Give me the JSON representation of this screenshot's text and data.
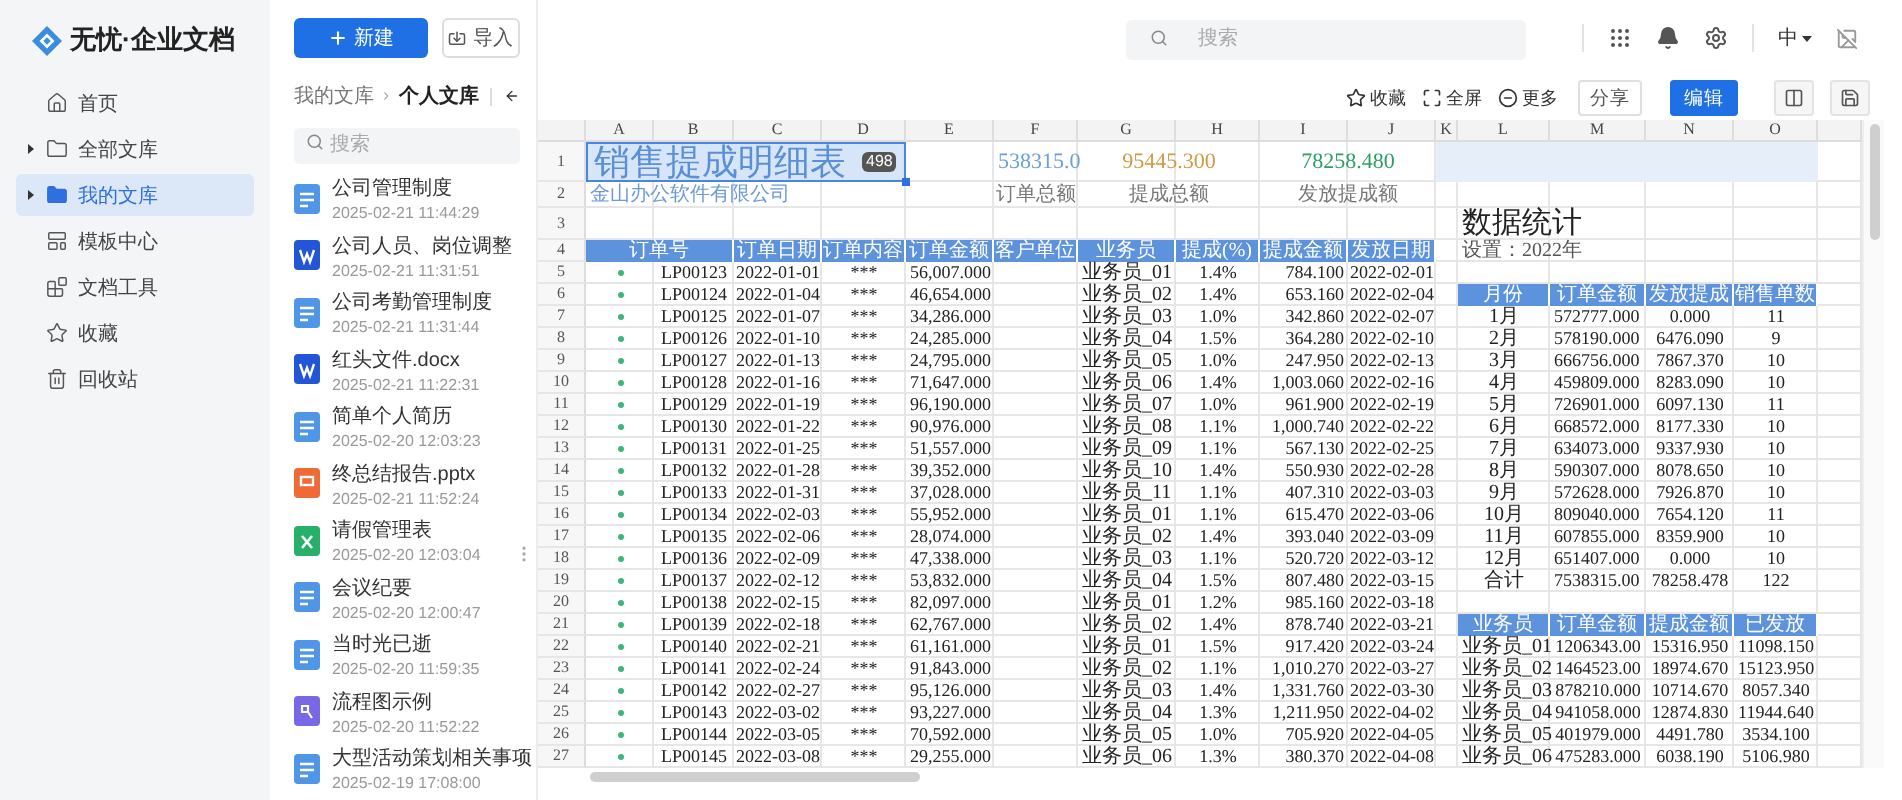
{
  "brand": {
    "name": "无忧·企业文档"
  },
  "sidebar": {
    "items": [
      {
        "label": "首页",
        "kind": "home",
        "expandable": false,
        "selected": false
      },
      {
        "label": "全部文库",
        "kind": "folder",
        "expandable": true,
        "selected": false
      },
      {
        "label": "我的文库",
        "kind": "folder",
        "expandable": true,
        "selected": true
      },
      {
        "label": "模板中心",
        "kind": "template",
        "expandable": false,
        "selected": false
      },
      {
        "label": "文档工具",
        "kind": "tools",
        "expandable": false,
        "selected": false
      },
      {
        "label": "收藏",
        "kind": "star",
        "expandable": false,
        "selected": false
      },
      {
        "label": "回收站",
        "kind": "trash",
        "expandable": false,
        "selected": false
      }
    ]
  },
  "doc_panel": {
    "new_button": "新建",
    "import_button": "导入",
    "breadcrumb": {
      "parent": "我的文库",
      "current": "个人文库"
    },
    "search": {
      "placeholder": "搜索"
    },
    "documents": [
      {
        "title": "公司管理制度",
        "time": "2025-02-21 11:44:29",
        "kind": "text"
      },
      {
        "title": "公司人员、岗位调整",
        "time": "2025-02-21 11:31:51",
        "kind": "word"
      },
      {
        "title": "公司考勤管理制度",
        "time": "2025-02-21 11:31:44",
        "kind": "text"
      },
      {
        "title": "红头文件.docx",
        "time": "2025-02-21 11:22:31",
        "kind": "word"
      },
      {
        "title": "简单个人简历",
        "time": "2025-02-20 12:03:23",
        "kind": "text"
      },
      {
        "title": "终总结报告.pptx",
        "time": "2025-02-21 11:52:24",
        "kind": "slides"
      },
      {
        "title": "请假管理表",
        "time": "2025-02-20 12:03:04",
        "kind": "sheet"
      },
      {
        "title": "会议纪要",
        "time": "2025-02-20 12:00:47",
        "kind": "text"
      },
      {
        "title": "当时光已逝",
        "time": "2025-02-20 11:59:35",
        "kind": "text"
      },
      {
        "title": "流程图示例",
        "time": "2025-02-20 11:52:22",
        "kind": "flow"
      },
      {
        "title": "大型活动策划相关事项",
        "time": "2025-02-19 17:08:00",
        "kind": "text"
      }
    ]
  },
  "header": {
    "search": {
      "placeholder": "搜索"
    },
    "language": "中"
  },
  "toolbar": {
    "favorite": "收藏",
    "fullscreen": "全屏",
    "more": "更多",
    "share": "分享",
    "edit": "编辑"
  },
  "sheet": {
    "columns": [
      "A",
      "B",
      "C",
      "D",
      "E",
      "F",
      "G",
      "H",
      "I",
      "J",
      "K",
      "L",
      "M",
      "N",
      "O"
    ],
    "row_numbers": [
      "1",
      "2",
      "3",
      "4",
      "5",
      "6",
      "7",
      "8",
      "9",
      "10",
      "11",
      "12",
      "13",
      "14",
      "15",
      "16",
      "17",
      "18",
      "19",
      "20",
      "21",
      "22",
      "23",
      "24",
      "25",
      "26",
      "27"
    ],
    "title": "销售提成明细表",
    "selection_badge": "498",
    "company": "金山办公软件有限公司",
    "summary": [
      {
        "value": "538315.0",
        "label": "订单总额",
        "color": "#6a9fd8"
      },
      {
        "value": "95445.300",
        "label": "提成总额",
        "color": "#d19a45"
      },
      {
        "value": "78258.480",
        "label": "发放提成额",
        "color": "#2f9e63"
      }
    ],
    "table": {
      "columns": [
        "订单号",
        "订单日期",
        "订单内容",
        "订单金额",
        "客户单位",
        "业务员",
        "提成(%)",
        "提成金额",
        "发放日期"
      ],
      "rows": [
        [
          "LP00123",
          "2022-01-01",
          "***",
          "56,007.000",
          "",
          "业务员_01",
          "1.4%",
          "784.100",
          "2022-02-01"
        ],
        [
          "LP00124",
          "2022-01-04",
          "***",
          "46,654.000",
          "",
          "业务员_02",
          "1.4%",
          "653.160",
          "2022-02-04"
        ],
        [
          "LP00125",
          "2022-01-07",
          "***",
          "34,286.000",
          "",
          "业务员_03",
          "1.0%",
          "342.860",
          "2022-02-07"
        ],
        [
          "LP00126",
          "2022-01-10",
          "***",
          "24,285.000",
          "",
          "业务员_04",
          "1.5%",
          "364.280",
          "2022-02-10"
        ],
        [
          "LP00127",
          "2022-01-13",
          "***",
          "24,795.000",
          "",
          "业务员_05",
          "1.0%",
          "247.950",
          "2022-02-13"
        ],
        [
          "LP00128",
          "2022-01-16",
          "***",
          "71,647.000",
          "",
          "业务员_06",
          "1.4%",
          "1,003.060",
          "2022-02-16"
        ],
        [
          "LP00129",
          "2022-01-19",
          "***",
          "96,190.000",
          "",
          "业务员_07",
          "1.0%",
          "961.900",
          "2022-02-19"
        ],
        [
          "LP00130",
          "2022-01-22",
          "***",
          "90,976.000",
          "",
          "业务员_08",
          "1.1%",
          "1,000.740",
          "2022-02-22"
        ],
        [
          "LP00131",
          "2022-01-25",
          "***",
          "51,557.000",
          "",
          "业务员_09",
          "1.1%",
          "567.130",
          "2022-02-25"
        ],
        [
          "LP00132",
          "2022-01-28",
          "***",
          "39,352.000",
          "",
          "业务员_10",
          "1.4%",
          "550.930",
          "2022-02-28"
        ],
        [
          "LP00133",
          "2022-01-31",
          "***",
          "37,028.000",
          "",
          "业务员_11",
          "1.1%",
          "407.310",
          "2022-03-03"
        ],
        [
          "LP00134",
          "2022-02-03",
          "***",
          "55,952.000",
          "",
          "业务员_01",
          "1.1%",
          "615.470",
          "2022-03-06"
        ],
        [
          "LP00135",
          "2022-02-06",
          "***",
          "28,074.000",
          "",
          "业务员_02",
          "1.4%",
          "393.040",
          "2022-03-09"
        ],
        [
          "LP00136",
          "2022-02-09",
          "***",
          "47,338.000",
          "",
          "业务员_03",
          "1.1%",
          "520.720",
          "2022-03-12"
        ],
        [
          "LP00137",
          "2022-02-12",
          "***",
          "53,832.000",
          "",
          "业务员_04",
          "1.5%",
          "807.480",
          "2022-03-15"
        ],
        [
          "LP00138",
          "2022-02-15",
          "***",
          "82,097.000",
          "",
          "业务员_01",
          "1.2%",
          "985.160",
          "2022-03-18"
        ],
        [
          "LP00139",
          "2022-02-18",
          "***",
          "62,767.000",
          "",
          "业务员_02",
          "1.4%",
          "878.740",
          "2022-03-21"
        ],
        [
          "LP00140",
          "2022-02-21",
          "***",
          "61,161.000",
          "",
          "业务员_01",
          "1.5%",
          "917.420",
          "2022-03-24"
        ],
        [
          "LP00141",
          "2022-02-24",
          "***",
          "91,843.000",
          "",
          "业务员_02",
          "1.1%",
          "1,010.270",
          "2022-03-27"
        ],
        [
          "LP00142",
          "2022-02-27",
          "***",
          "95,126.000",
          "",
          "业务员_03",
          "1.4%",
          "1,331.760",
          "2022-03-30"
        ],
        [
          "LP00143",
          "2022-03-02",
          "***",
          "93,227.000",
          "",
          "业务员_04",
          "1.3%",
          "1,211.950",
          "2022-04-02"
        ],
        [
          "LP00144",
          "2022-03-05",
          "***",
          "70,592.000",
          "",
          "业务员_05",
          "1.0%",
          "705.920",
          "2022-04-05"
        ],
        [
          "LP00145",
          "2022-03-08",
          "***",
          "29,255.000",
          "",
          "业务员_06",
          "1.3%",
          "380.370",
          "2022-04-08"
        ]
      ]
    },
    "stats": {
      "title": "数据统计",
      "setting": "设置：2022年",
      "monthly": {
        "columns": [
          "月份",
          "订单金额",
          "发放提成",
          "销售单数"
        ],
        "rows": [
          [
            "1月",
            "572777.000",
            "0.000",
            "11"
          ],
          [
            "2月",
            "578190.000",
            "6476.090",
            "9"
          ],
          [
            "3月",
            "666756.000",
            "7867.370",
            "10"
          ],
          [
            "4月",
            "459809.000",
            "8283.090",
            "10"
          ],
          [
            "5月",
            "726901.000",
            "6097.130",
            "11"
          ],
          [
            "6月",
            "668572.000",
            "8177.330",
            "10"
          ],
          [
            "7月",
            "634073.000",
            "9337.930",
            "10"
          ],
          [
            "8月",
            "590307.000",
            "8078.650",
            "10"
          ],
          [
            "9月",
            "572628.000",
            "7926.870",
            "10"
          ],
          [
            "10月",
            "809040.000",
            "7654.120",
            "11"
          ],
          [
            "11月",
            "607855.000",
            "8359.900",
            "10"
          ],
          [
            "12月",
            "651407.000",
            "0.000",
            "10"
          ],
          [
            "合计",
            "7538315.00",
            "78258.478",
            "122"
          ]
        ]
      },
      "by_salesperson": {
        "columns": [
          "业务员",
          "订单金额",
          "提成金额",
          "已发放"
        ],
        "rows": [
          [
            "业务员_01",
            "1206343.00",
            "15316.950",
            "11098.150"
          ],
          [
            "业务员_02",
            "1464523.00",
            "18974.670",
            "15123.950"
          ],
          [
            "业务员_03",
            "878210.000",
            "10714.670",
            "8057.340"
          ],
          [
            "业务员_04",
            "941058.000",
            "12874.830",
            "11944.640"
          ],
          [
            "业务员_05",
            "401979.000",
            "4491.780",
            "3534.100"
          ],
          [
            "业务员_06",
            "475283.000",
            "6038.190",
            "5106.980"
          ]
        ]
      }
    }
  }
}
